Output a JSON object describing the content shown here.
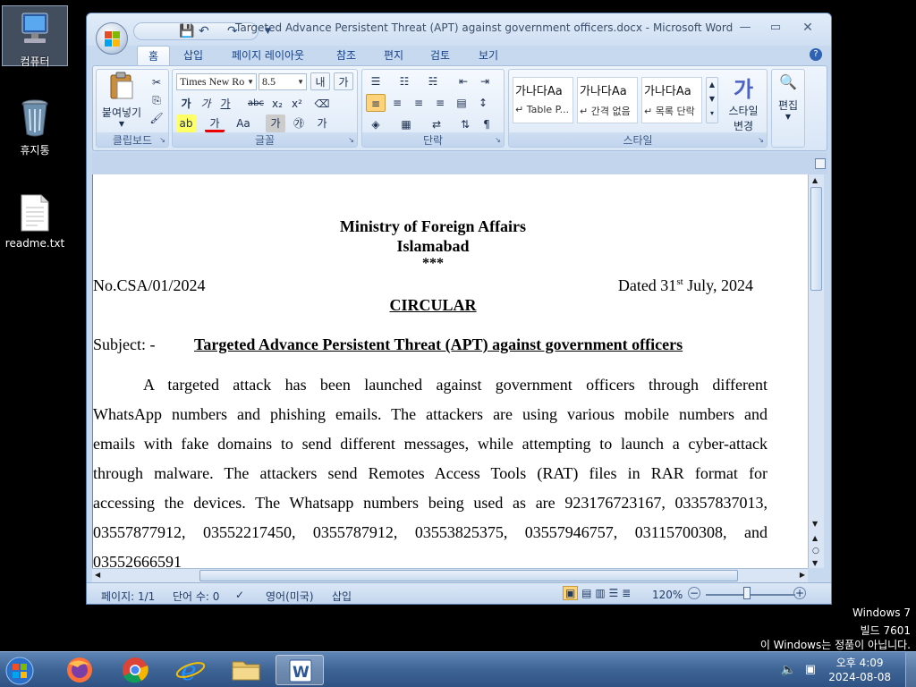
{
  "desktop": {
    "icons": [
      {
        "label": "컴퓨터"
      },
      {
        "label": "휴지통"
      },
      {
        "label": "readme.txt"
      }
    ]
  },
  "window": {
    "title": "Targeted Advance Persistent Threat (APT) against government officers.docx - Microsoft Word",
    "tabs": [
      "홈",
      "삽입",
      "페이지 레이아웃",
      "참조",
      "편지",
      "검토",
      "보기"
    ]
  },
  "ribbon": {
    "clipboard": {
      "paste": "붙여넣기",
      "label": "클립보드"
    },
    "font": {
      "name": "Times New Ro",
      "size": "8.5",
      "label": "글꼴"
    },
    "paragraph": {
      "label": "단락"
    },
    "styles": {
      "label": "스타일",
      "cards": [
        {
          "preview": "가나다Aa",
          "name": "↵ Table P..."
        },
        {
          "preview": "가나다Aa",
          "name": "↵ 간격 없음"
        },
        {
          "preview": "가나다Aa",
          "name": "↵ 목록 단락"
        }
      ],
      "change_line1": "스타일",
      "change_line2": "변경"
    },
    "editing": {
      "label": "편집"
    }
  },
  "document": {
    "heading1": "Ministry of Foreign Affairs",
    "heading2": "Islamabad",
    "heading3": "***",
    "ref_no": "No.CSA/01/2024",
    "date_prefix": "Dated 31",
    "date_sup": "st",
    "date_suffix": " July, 2024",
    "circular": "CIRCULAR",
    "subject_label": "Subject: -",
    "subject_text": "Targeted Advance Persistent Threat (APT) against government officers",
    "lines": [
      "A targeted attack has been launched against government officers through different",
      "WhatsApp numbers and phishing emails. The attackers are using various mobile numbers and",
      "emails with fake domains to send different messages, while attempting to launch a cyber-attack",
      "through malware. The attackers send Remotes Access Tools (RAT) files in RAR format for",
      "accessing the devices. The Whatsapp numbers being used as are 923176723167, 03357837013,",
      "03557877912, 03552217450, 0355787912, 03553825375, 03557946757, 03115700308, and",
      "03552666591"
    ]
  },
  "statusbar": {
    "page": "페이지: 1/1",
    "words": "단어 수: 0",
    "language": "영어(미국)",
    "mode": "삽입",
    "zoom": "120%"
  },
  "watermark": {
    "line1": "Windows 7",
    "line2": "빌드 7601",
    "line3": "이 Windows는 정품이 아닙니다."
  },
  "taskbar": {
    "time": "오후 4:09",
    "date": "2024-08-08"
  },
  "colors": {
    "accent": "#2b579a",
    "ribbon_bg": "#dde9f7"
  }
}
